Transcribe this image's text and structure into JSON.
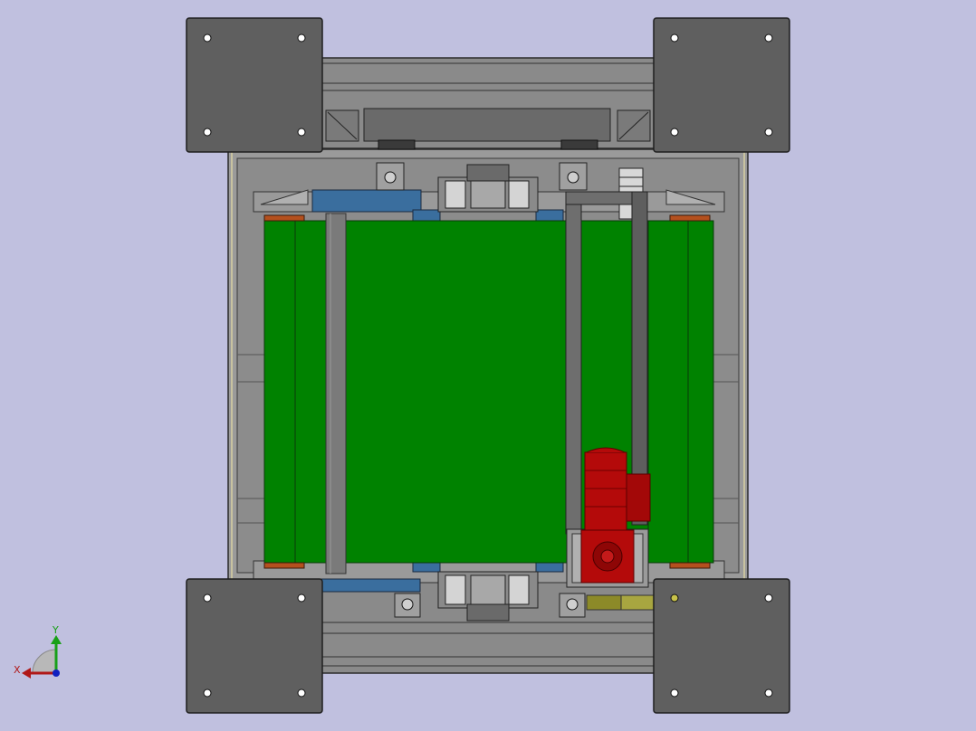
{
  "view": {
    "background": "#c0c0df",
    "model": "conveyor-assembly-top-view"
  },
  "colors": {
    "plate": "#5f5f5f",
    "plate_edge": "#1e1e1e",
    "frame": "#8a8a8a",
    "frame_dark": "#6b6b6b",
    "belt": "#008200",
    "belt_line": "#0a3a0a",
    "blue_bar": "#3a6e9e",
    "orange_strip": "#b4501e",
    "motor": "#b40a0a",
    "motor_dark": "#6e0000",
    "yellow_bar": "#8c8a28",
    "bearing": "#cfcfcf"
  },
  "triad": {
    "x_label": "X",
    "y_label": "Y",
    "x_color": "#b01818",
    "y_color": "#18a018",
    "z_color": "#1020c0"
  }
}
